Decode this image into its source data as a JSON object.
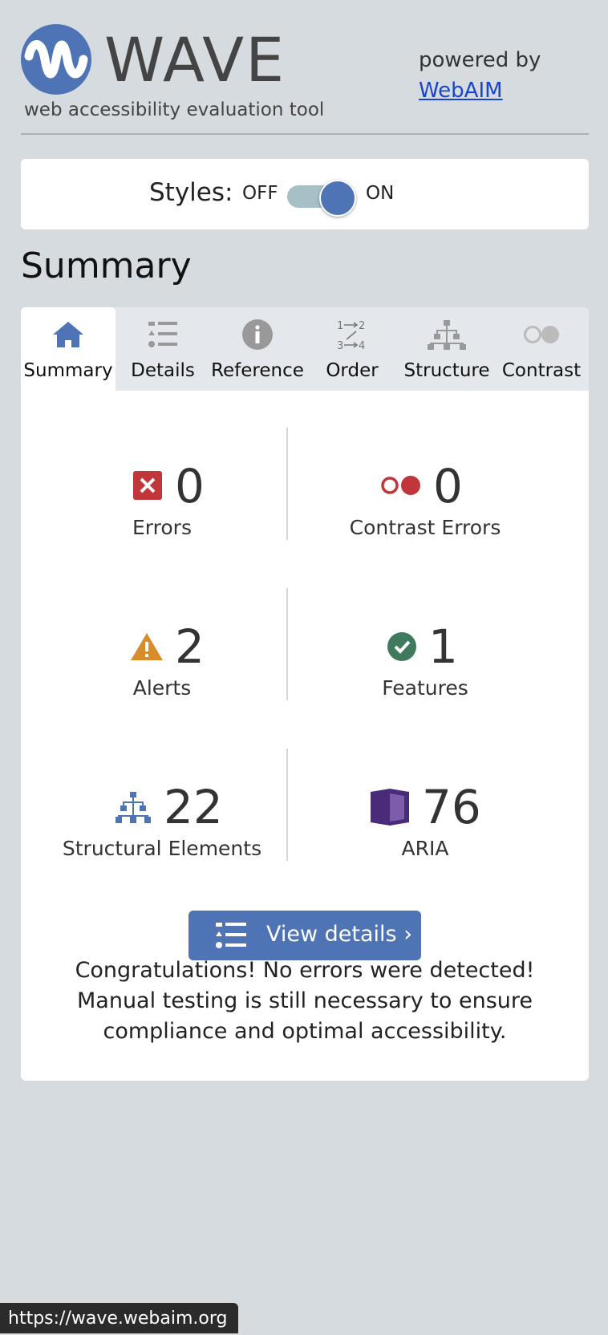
{
  "header": {
    "app_name": "WAVE",
    "tagline": "web accessibility evaluation tool",
    "powered_by": "powered by",
    "webaim_link": "WebAIM"
  },
  "styles_toggle": {
    "label": "Styles:",
    "off_label": "OFF",
    "on_label": "ON",
    "state": "on"
  },
  "page_title": "Summary",
  "tabs": [
    {
      "label": "Summary",
      "icon": "home-icon",
      "active": true
    },
    {
      "label": "Details",
      "icon": "list-icon",
      "active": false
    },
    {
      "label": "Reference",
      "icon": "info-icon",
      "active": false
    },
    {
      "label": "Order",
      "icon": "order-icon",
      "active": false
    },
    {
      "label": "Structure",
      "icon": "structure-icon",
      "active": false
    },
    {
      "label": "Contrast",
      "icon": "contrast-icon",
      "active": false
    }
  ],
  "stats": {
    "errors": {
      "count": "0",
      "label": "Errors",
      "color": "#c0363a"
    },
    "contrast_errors": {
      "count": "0",
      "label": "Contrast Errors",
      "color": "#c0363a"
    },
    "alerts": {
      "count": "2",
      "label": "Alerts",
      "color": "#d98c2b"
    },
    "features": {
      "count": "1",
      "label": "Features",
      "color": "#3f7a5e"
    },
    "structural_elements": {
      "count": "22",
      "label": "Structural Elements",
      "color": "#4f74b6"
    },
    "aria": {
      "count": "76",
      "label": "ARIA",
      "color": "#4a2b7a"
    }
  },
  "view_details_button": "View details ›",
  "congrats_message": "Congratulations! No errors were detected! Manual testing is still necessary to ensure compliance and optimal accessibility.",
  "status_bar_url": "https://wave.webaim.org",
  "colors": {
    "accent": "#4f74b6",
    "background": "#d6dbe0"
  }
}
